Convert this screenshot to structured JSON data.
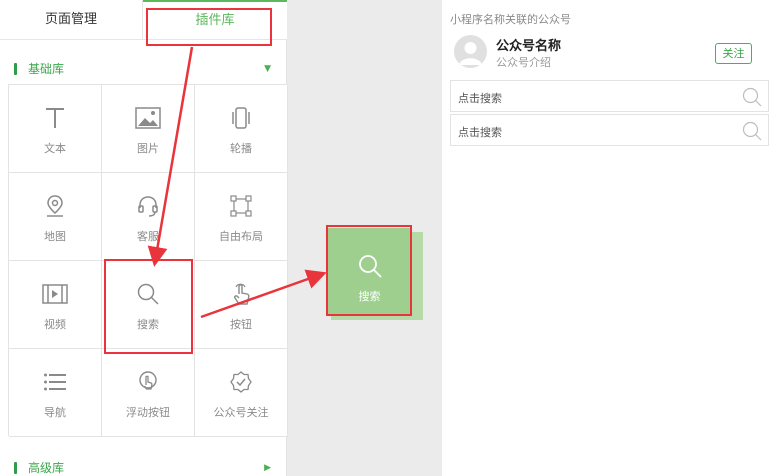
{
  "tabs": {
    "page_manage": "页面管理",
    "plugin_lib": "插件库"
  },
  "sections": {
    "basic": {
      "title": "基础库",
      "state": "expanded"
    },
    "advanced": {
      "title": "高级库",
      "state": "collapsed"
    }
  },
  "plugins": [
    {
      "label": "文本",
      "icon": "text-icon"
    },
    {
      "label": "图片",
      "icon": "image-icon"
    },
    {
      "label": "轮播",
      "icon": "carousel-icon"
    },
    {
      "label": "地图",
      "icon": "map-pin-icon"
    },
    {
      "label": "客服",
      "icon": "headset-icon"
    },
    {
      "label": "自由布局",
      "icon": "free-layout-icon"
    },
    {
      "label": "视频",
      "icon": "video-icon"
    },
    {
      "label": "搜索",
      "icon": "search-icon"
    },
    {
      "label": "按钮",
      "icon": "tap-icon"
    },
    {
      "label": "导航",
      "icon": "nav-list-icon"
    },
    {
      "label": "浮动按钮",
      "icon": "float-button-icon"
    },
    {
      "label": "公众号关注",
      "icon": "badge-check-icon"
    }
  ],
  "drag_item": {
    "label": "搜索",
    "icon": "search-icon"
  },
  "preview": {
    "title": "小程序名称关联的公众号",
    "account_name": "公众号名称",
    "account_desc": "公众号介绍",
    "follow_label": "关注",
    "search_rows": [
      "点击搜索",
      "点击搜索"
    ]
  },
  "colors": {
    "accent_green": "#4caf50",
    "drag_green": "#9ecf8f",
    "highlight_red": "#e8343a"
  }
}
